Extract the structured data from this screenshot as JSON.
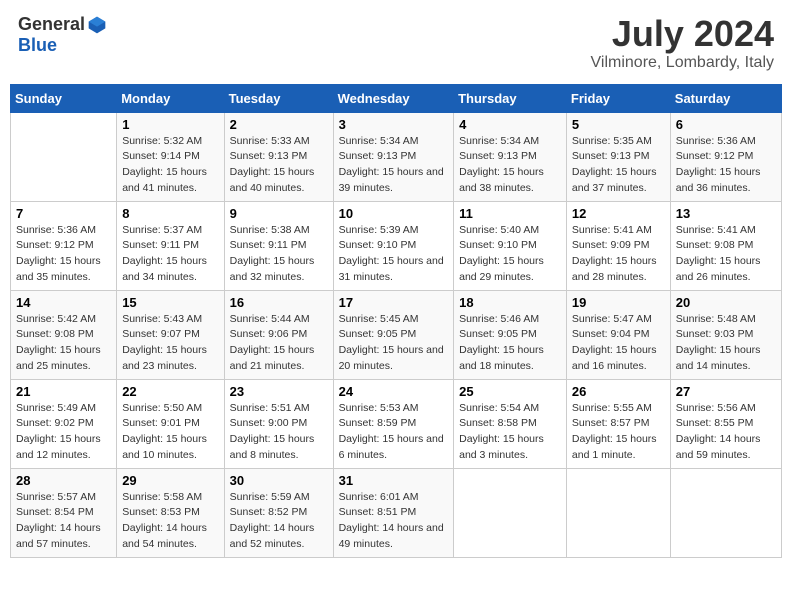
{
  "logo": {
    "general": "General",
    "blue": "Blue"
  },
  "title": "July 2024",
  "location": "Vilminore, Lombardy, Italy",
  "days_of_week": [
    "Sunday",
    "Monday",
    "Tuesday",
    "Wednesday",
    "Thursday",
    "Friday",
    "Saturday"
  ],
  "weeks": [
    [
      {
        "day": "",
        "sunrise": "",
        "sunset": "",
        "daylight": ""
      },
      {
        "day": "1",
        "sunrise": "Sunrise: 5:32 AM",
        "sunset": "Sunset: 9:14 PM",
        "daylight": "Daylight: 15 hours and 41 minutes."
      },
      {
        "day": "2",
        "sunrise": "Sunrise: 5:33 AM",
        "sunset": "Sunset: 9:13 PM",
        "daylight": "Daylight: 15 hours and 40 minutes."
      },
      {
        "day": "3",
        "sunrise": "Sunrise: 5:34 AM",
        "sunset": "Sunset: 9:13 PM",
        "daylight": "Daylight: 15 hours and 39 minutes."
      },
      {
        "day": "4",
        "sunrise": "Sunrise: 5:34 AM",
        "sunset": "Sunset: 9:13 PM",
        "daylight": "Daylight: 15 hours and 38 minutes."
      },
      {
        "day": "5",
        "sunrise": "Sunrise: 5:35 AM",
        "sunset": "Sunset: 9:13 PM",
        "daylight": "Daylight: 15 hours and 37 minutes."
      },
      {
        "day": "6",
        "sunrise": "Sunrise: 5:36 AM",
        "sunset": "Sunset: 9:12 PM",
        "daylight": "Daylight: 15 hours and 36 minutes."
      }
    ],
    [
      {
        "day": "7",
        "sunrise": "Sunrise: 5:36 AM",
        "sunset": "Sunset: 9:12 PM",
        "daylight": "Daylight: 15 hours and 35 minutes."
      },
      {
        "day": "8",
        "sunrise": "Sunrise: 5:37 AM",
        "sunset": "Sunset: 9:11 PM",
        "daylight": "Daylight: 15 hours and 34 minutes."
      },
      {
        "day": "9",
        "sunrise": "Sunrise: 5:38 AM",
        "sunset": "Sunset: 9:11 PM",
        "daylight": "Daylight: 15 hours and 32 minutes."
      },
      {
        "day": "10",
        "sunrise": "Sunrise: 5:39 AM",
        "sunset": "Sunset: 9:10 PM",
        "daylight": "Daylight: 15 hours and 31 minutes."
      },
      {
        "day": "11",
        "sunrise": "Sunrise: 5:40 AM",
        "sunset": "Sunset: 9:10 PM",
        "daylight": "Daylight: 15 hours and 29 minutes."
      },
      {
        "day": "12",
        "sunrise": "Sunrise: 5:41 AM",
        "sunset": "Sunset: 9:09 PM",
        "daylight": "Daylight: 15 hours and 28 minutes."
      },
      {
        "day": "13",
        "sunrise": "Sunrise: 5:41 AM",
        "sunset": "Sunset: 9:08 PM",
        "daylight": "Daylight: 15 hours and 26 minutes."
      }
    ],
    [
      {
        "day": "14",
        "sunrise": "Sunrise: 5:42 AM",
        "sunset": "Sunset: 9:08 PM",
        "daylight": "Daylight: 15 hours and 25 minutes."
      },
      {
        "day": "15",
        "sunrise": "Sunrise: 5:43 AM",
        "sunset": "Sunset: 9:07 PM",
        "daylight": "Daylight: 15 hours and 23 minutes."
      },
      {
        "day": "16",
        "sunrise": "Sunrise: 5:44 AM",
        "sunset": "Sunset: 9:06 PM",
        "daylight": "Daylight: 15 hours and 21 minutes."
      },
      {
        "day": "17",
        "sunrise": "Sunrise: 5:45 AM",
        "sunset": "Sunset: 9:05 PM",
        "daylight": "Daylight: 15 hours and 20 minutes."
      },
      {
        "day": "18",
        "sunrise": "Sunrise: 5:46 AM",
        "sunset": "Sunset: 9:05 PM",
        "daylight": "Daylight: 15 hours and 18 minutes."
      },
      {
        "day": "19",
        "sunrise": "Sunrise: 5:47 AM",
        "sunset": "Sunset: 9:04 PM",
        "daylight": "Daylight: 15 hours and 16 minutes."
      },
      {
        "day": "20",
        "sunrise": "Sunrise: 5:48 AM",
        "sunset": "Sunset: 9:03 PM",
        "daylight": "Daylight: 15 hours and 14 minutes."
      }
    ],
    [
      {
        "day": "21",
        "sunrise": "Sunrise: 5:49 AM",
        "sunset": "Sunset: 9:02 PM",
        "daylight": "Daylight: 15 hours and 12 minutes."
      },
      {
        "day": "22",
        "sunrise": "Sunrise: 5:50 AM",
        "sunset": "Sunset: 9:01 PM",
        "daylight": "Daylight: 15 hours and 10 minutes."
      },
      {
        "day": "23",
        "sunrise": "Sunrise: 5:51 AM",
        "sunset": "Sunset: 9:00 PM",
        "daylight": "Daylight: 15 hours and 8 minutes."
      },
      {
        "day": "24",
        "sunrise": "Sunrise: 5:53 AM",
        "sunset": "Sunset: 8:59 PM",
        "daylight": "Daylight: 15 hours and 6 minutes."
      },
      {
        "day": "25",
        "sunrise": "Sunrise: 5:54 AM",
        "sunset": "Sunset: 8:58 PM",
        "daylight": "Daylight: 15 hours and 3 minutes."
      },
      {
        "day": "26",
        "sunrise": "Sunrise: 5:55 AM",
        "sunset": "Sunset: 8:57 PM",
        "daylight": "Daylight: 15 hours and 1 minute."
      },
      {
        "day": "27",
        "sunrise": "Sunrise: 5:56 AM",
        "sunset": "Sunset: 8:55 PM",
        "daylight": "Daylight: 14 hours and 59 minutes."
      }
    ],
    [
      {
        "day": "28",
        "sunrise": "Sunrise: 5:57 AM",
        "sunset": "Sunset: 8:54 PM",
        "daylight": "Daylight: 14 hours and 57 minutes."
      },
      {
        "day": "29",
        "sunrise": "Sunrise: 5:58 AM",
        "sunset": "Sunset: 8:53 PM",
        "daylight": "Daylight: 14 hours and 54 minutes."
      },
      {
        "day": "30",
        "sunrise": "Sunrise: 5:59 AM",
        "sunset": "Sunset: 8:52 PM",
        "daylight": "Daylight: 14 hours and 52 minutes."
      },
      {
        "day": "31",
        "sunrise": "Sunrise: 6:01 AM",
        "sunset": "Sunset: 8:51 PM",
        "daylight": "Daylight: 14 hours and 49 minutes."
      },
      {
        "day": "",
        "sunrise": "",
        "sunset": "",
        "daylight": ""
      },
      {
        "day": "",
        "sunrise": "",
        "sunset": "",
        "daylight": ""
      },
      {
        "day": "",
        "sunrise": "",
        "sunset": "",
        "daylight": ""
      }
    ]
  ]
}
